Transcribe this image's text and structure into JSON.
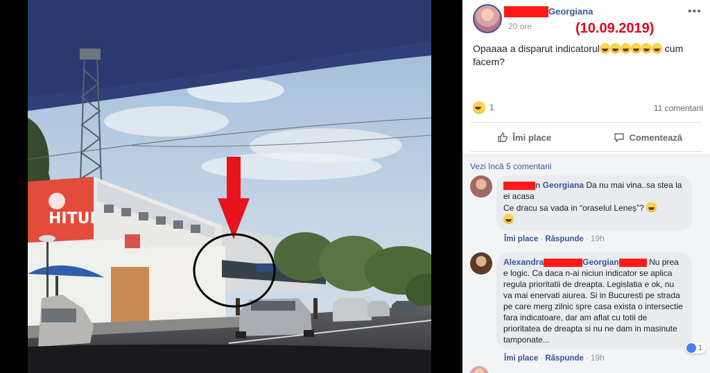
{
  "post": {
    "author_name": "Georgiana",
    "time": "20 ore",
    "date_stamp": "(10.09.2019)",
    "text": "Opaaaa a disparut indicatorul",
    "text_end": " cum facem?",
    "emoji_count": 6,
    "reaction_count": "1",
    "comments_count": "11 comentarii"
  },
  "actions": {
    "like_label": "Îmi place",
    "comment_label": "Comentează"
  },
  "comments": {
    "view_more": "Vezi încă 5 comentarii",
    "items": [
      {
        "name_suffix": "n Georgiana",
        "text_line1": "Da nu mai vina..sa stea la ei acasa",
        "text_line2": "Ce dracu sa vada in “oraselul Leneș”?",
        "like": "Îmi place",
        "reply": "Răspunde",
        "time": "19h"
      },
      {
        "name": "Alexandra",
        "mention": "Georgian",
        "text": "Nu prea e logic. Ca daca n-ai niciun indicator se aplica regula prioritatii de dreapta. Legislatia e ok, nu va mai enervati aiurea. Si in Bucuresti pe strada pe care merg zilnic spre casa exista o intersectie fara indicatoare, dar am aflat cu totii de prioritatea de dreapta si nu ne dam in masinute tamponate...",
        "like": "Îmi place",
        "reply": "Răspunde",
        "time": "19h",
        "likes": "1"
      }
    ]
  },
  "photo": {
    "sign_text": "HITURI",
    "description_icon": "street-photo"
  },
  "colors": {
    "link": "#385898",
    "redaction": "#ff1a1a",
    "date_stamp": "#e4001a",
    "arrow": "#e8141c"
  }
}
